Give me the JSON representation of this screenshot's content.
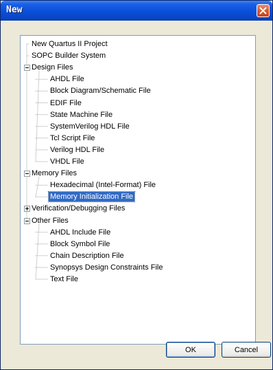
{
  "window": {
    "title": "New",
    "close_label": "Close"
  },
  "tree": {
    "nodes": [
      {
        "label": "New Quartus II Project",
        "type": "leaf",
        "level": 0
      },
      {
        "label": "SOPC Builder System",
        "type": "leaf",
        "level": 0
      },
      {
        "label": "Design Files",
        "type": "folder",
        "expanded": true,
        "level": 0
      },
      {
        "label": "AHDL File",
        "type": "leaf",
        "level": 1
      },
      {
        "label": "Block Diagram/Schematic File",
        "type": "leaf",
        "level": 1
      },
      {
        "label": "EDIF File",
        "type": "leaf",
        "level": 1
      },
      {
        "label": "State Machine File",
        "type": "leaf",
        "level": 1
      },
      {
        "label": "SystemVerilog HDL File",
        "type": "leaf",
        "level": 1
      },
      {
        "label": "Tcl Script File",
        "type": "leaf",
        "level": 1
      },
      {
        "label": "Verilog HDL File",
        "type": "leaf",
        "level": 1
      },
      {
        "label": "VHDL File",
        "type": "leaf",
        "level": 1
      },
      {
        "label": "Memory Files",
        "type": "folder",
        "expanded": true,
        "level": 0
      },
      {
        "label": "Hexadecimal (Intel-Format) File",
        "type": "leaf",
        "level": 1
      },
      {
        "label": "Memory Initialization File",
        "type": "leaf",
        "level": 1,
        "selected": true
      },
      {
        "label": "Verification/Debugging Files",
        "type": "folder",
        "expanded": false,
        "level": 0
      },
      {
        "label": "Other Files",
        "type": "folder",
        "expanded": true,
        "level": 0
      },
      {
        "label": "AHDL Include File",
        "type": "leaf",
        "level": 1
      },
      {
        "label": "Block Symbol File",
        "type": "leaf",
        "level": 1
      },
      {
        "label": "Chain Description File",
        "type": "leaf",
        "level": 1
      },
      {
        "label": "Synopsys Design Constraints File",
        "type": "leaf",
        "level": 1
      },
      {
        "label": "Text File",
        "type": "leaf",
        "level": 1
      }
    ]
  },
  "buttons": {
    "ok": "OK",
    "cancel": "Cancel"
  }
}
